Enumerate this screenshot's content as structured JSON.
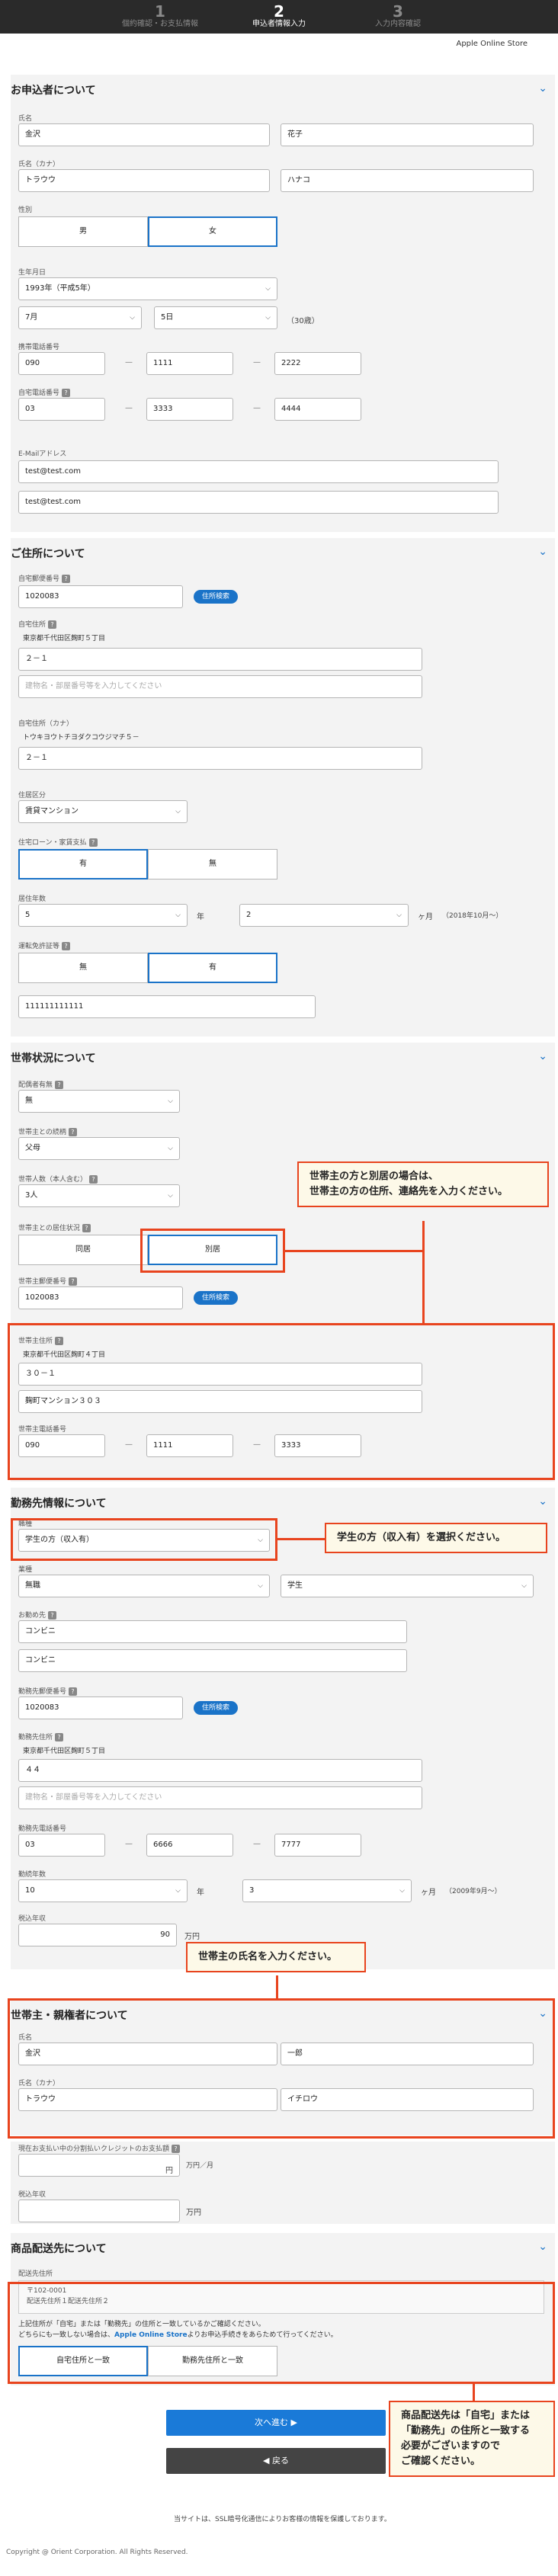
{
  "steps": [
    {
      "num": "1",
      "label": "個約確認・お支払情報"
    },
    {
      "num": "2",
      "label": "申込者情報入力"
    },
    {
      "num": "3",
      "label": "入力内容確認"
    }
  ],
  "brand": "Apple Online Store",
  "applicant": {
    "title": "お申込者について",
    "name_label": "氏名",
    "last_name": "金沢",
    "first_name": "花子",
    "kana_label": "氏名（カナ）",
    "last_kana": "トラウウ",
    "first_kana": "ハナコ",
    "gender_label": "性別",
    "gender_male": "男",
    "gender_female": "女",
    "dob_label": "生年月日",
    "dob_year": "1993年（平成5年）",
    "dob_month": "7月",
    "dob_day": "5日",
    "age": "（30歳）",
    "mobile_label": "携帯電話番号",
    "mobile": [
      "090",
      "1111",
      "2222"
    ],
    "home_label": "自宅電話番号",
    "home": [
      "03",
      "3333",
      "4444"
    ],
    "email_label": "E-Mailアドレス",
    "email": "test@test.com",
    "email_confirm": "test@test.com"
  },
  "residence": {
    "title": "ご住所について",
    "zip_label": "自宅郵便番号",
    "zip": "1020083",
    "search_label": "住所検索",
    "addr_label": "自宅住所",
    "addr_static": "東京都千代田区麹町５丁目",
    "addr_num": "２－１",
    "addr_bldg_placeholder": "建物名・部屋番号等を入力してください",
    "addr_kana_label": "自宅住所（カナ）",
    "addr_kana_static": "トウキヨウトチヨダクコウジマチ５－",
    "addr_kana_num": "２－１",
    "type_label": "住居区分",
    "type": "賃貸マンション",
    "loan_label": "住宅ローン・家賃支払",
    "loan_yes": "有",
    "loan_no": "無",
    "years_label": "居住年数",
    "years": "5",
    "years_unit": "年",
    "months": "2",
    "months_unit": "ヶ月",
    "since": "（2018年10月～）",
    "cert_label": "運転免許証等",
    "cert_no": "無",
    "cert_yes": "有",
    "cert_number": "111111111111"
  },
  "household": {
    "title": "世帯状況について",
    "spouse_label": "配偶者有無",
    "spouse": "無",
    "relation_label": "世帯主との続柄",
    "relation": "父母",
    "members_label": "世帯人数（本人含む）",
    "members": "3人",
    "living_label": "世帯主との居住状況",
    "living_same": "同居",
    "living_separate": "別居",
    "zip_label": "世帯主郵便番号",
    "zip": "1020083",
    "search_label": "住所検索",
    "addr_label": "世帯主住所",
    "addr_static": "東京都千代田区麹町４丁目",
    "addr_num": "３０－１",
    "addr_bldg": "麹町マンション３０３",
    "phone_label": "世帯主電話番号",
    "phone": [
      "090",
      "1111",
      "3333"
    ],
    "callout": [
      "世帯主の方と別居の場合は、",
      "世帯主の方の住所、連絡先を入力ください。"
    ]
  },
  "work": {
    "title": "勤務先情報について",
    "job_label": "職種",
    "job": "学生の方（収入有）",
    "job_callout": "学生の方（収入有）を選択ください。",
    "industry_label": "業種",
    "industry": "無職",
    "industry2": "学生",
    "company_label": "お勤め先",
    "company": "コンビニ",
    "company_kana": "コンビニ",
    "zip_label": "勤務先郵便番号",
    "zip": "1020083",
    "search_label": "住所検索",
    "addr_label": "勤務先住所",
    "addr_static": "東京都千代田区麹町５丁目",
    "addr_num": "４４",
    "addr_bldg_placeholder": "建物名・部屋番号等を入力してください",
    "phone_label": "勤務先電話番号",
    "phone": [
      "03",
      "6666",
      "7777"
    ],
    "years_label": "勤続年数",
    "years": "10",
    "years_unit": "年",
    "months": "3",
    "months_unit": "ヶ月",
    "since": "（2009年9月～）",
    "income_label": "税込年収",
    "income": "90",
    "income_unit": "万円"
  },
  "head": {
    "callout": "世帯主の氏名を入力ください。",
    "title": "世帯主・親権者について",
    "name_label": "氏名",
    "last_name": "金沢",
    "first_name": "一郎",
    "kana_label": "氏名（カナ）",
    "last_kana": "トラウウ",
    "first_kana": "イチロウ",
    "credit_label": "現在お支払い中の分割払いクレジットのお支払額",
    "credit_unit": "円",
    "credit_unit2": "万円／月",
    "income_label": "税込年収",
    "income_unit": "万円"
  },
  "delivery": {
    "title": "商品配送先について",
    "addr_label": "配送先住所",
    "addr_lines": [
      "〒102-0001",
      "配送先住所１配送先住所２"
    ],
    "note1": "上記住所が「自宅」または「勤務先」の住所と一致しているかご確認ください。",
    "note2_pre": "どちらにも一致しない場合は、",
    "note2_link": "Apple Online Store",
    "note2_post": "よりお申込手続きをあらためて行ってください。",
    "opt_home": "自宅住所と一致",
    "opt_work": "勤務先住所と一致",
    "callout": [
      "商品配送先は「自宅」または",
      "「勤務先」の住所と一致する",
      "必要がございますので",
      "ご確認ください。"
    ]
  },
  "buttons": {
    "next": "次へ進む ▶",
    "back": "◀ 戻る"
  },
  "footer_note": "当サイトは、SSL暗号化通信によりお客様の情報を保護しております。",
  "copyright": "Copyright @ Orient Corporation. All Rights Reserved."
}
